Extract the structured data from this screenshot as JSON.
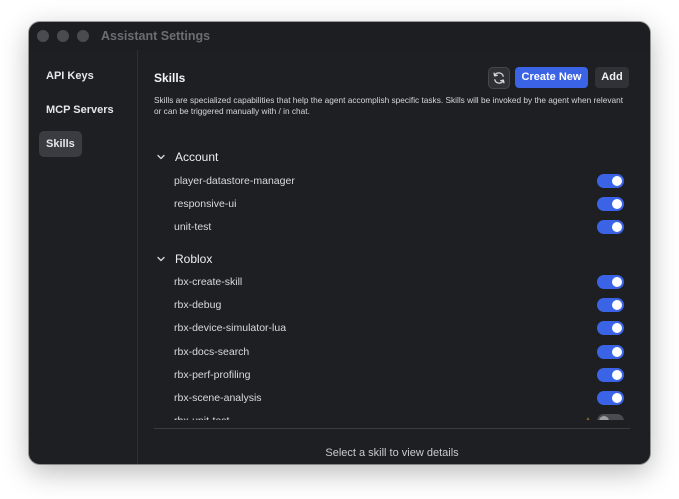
{
  "window": {
    "title": "Assistant Settings"
  },
  "sidebar": {
    "items": [
      {
        "label": "API Keys",
        "active": false
      },
      {
        "label": "MCP Servers",
        "active": false
      },
      {
        "label": "Skills",
        "active": true
      }
    ]
  },
  "header": {
    "title": "Skills",
    "refresh_icon": "refresh-icon",
    "create_label": "Create New",
    "add_label": "Add"
  },
  "description": "Skills are specialized capabilities that help the agent accomplish specific tasks. Skills will be invoked by the agent when relevant or can be triggered manually with / in chat.",
  "groups": [
    {
      "label": "Account",
      "expanded": true,
      "skills": [
        {
          "name": "player-datastore-manager",
          "enabled": true
        },
        {
          "name": "responsive-ui",
          "enabled": true
        },
        {
          "name": "unit-test",
          "enabled": true
        }
      ]
    },
    {
      "label": "Roblox",
      "expanded": true,
      "skills": [
        {
          "name": "rbx-create-skill",
          "enabled": true
        },
        {
          "name": "rbx-debug",
          "enabled": true
        },
        {
          "name": "rbx-device-simulator-lua",
          "enabled": true
        },
        {
          "name": "rbx-docs-search",
          "enabled": true
        },
        {
          "name": "rbx-perf-profiling",
          "enabled": true
        },
        {
          "name": "rbx-scene-analysis",
          "enabled": true
        },
        {
          "name": "rbx-unit-test",
          "enabled": false,
          "warning": "⚠"
        }
      ]
    }
  ],
  "detail_placeholder": "Select a skill to view details",
  "colors": {
    "accent": "#3b63e6",
    "window_bg": "#1e1f23",
    "warning": "#e3a93b"
  }
}
